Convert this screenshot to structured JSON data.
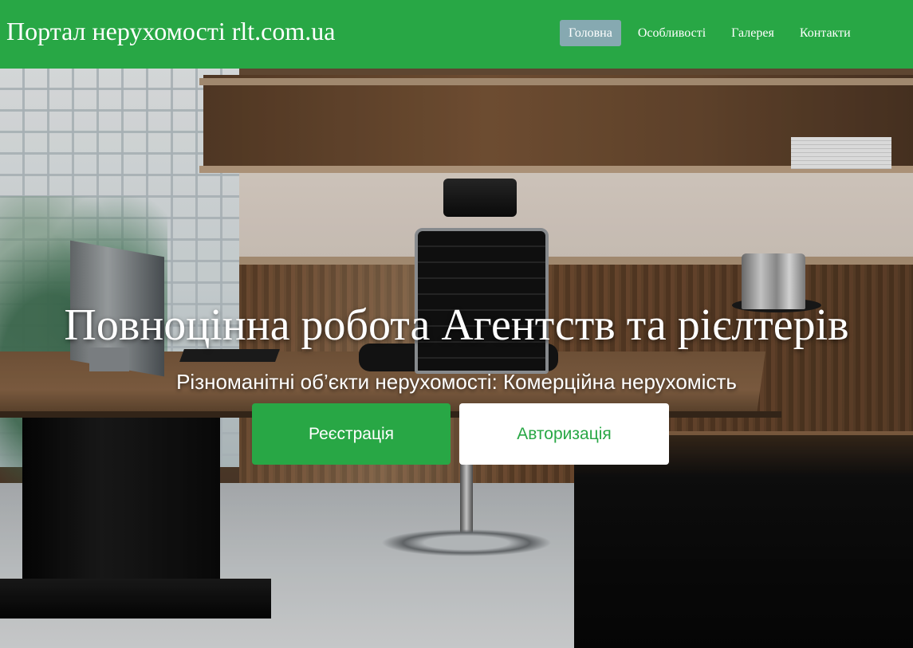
{
  "header": {
    "brand": "Портал нерухомості rlt.com.ua",
    "nav": [
      {
        "label": "Головна",
        "active": true
      },
      {
        "label": "Особливості",
        "active": false
      },
      {
        "label": "Галерея",
        "active": false
      },
      {
        "label": "Контакти",
        "active": false
      }
    ]
  },
  "hero": {
    "title": "Повноцінна робота Агентств та рієлтерів",
    "subtitle": "Різноманітні об’єкти нерухомості: Комерційна нерухомість",
    "register_label": "Реєстрація",
    "login_label": "Авторизація",
    "background": "office-interior-photo"
  },
  "colors": {
    "primary": "#28a745",
    "nav_active": "#86a9b1",
    "text_light": "#ffffff"
  }
}
